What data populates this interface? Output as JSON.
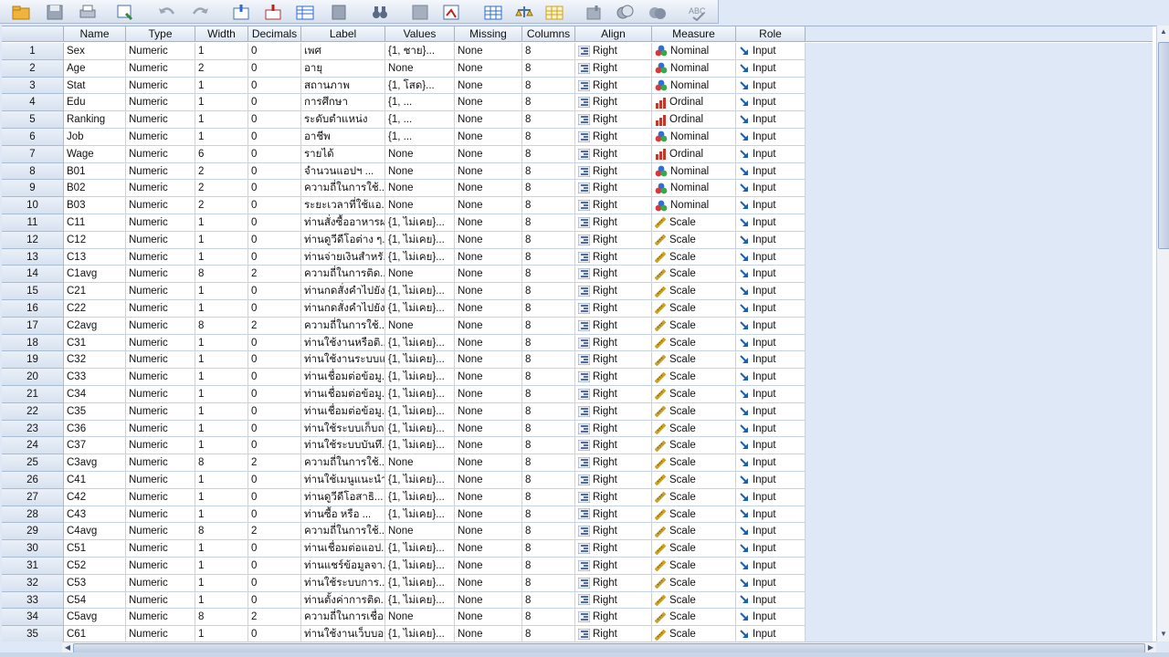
{
  "toolbar": {
    "buttons": [
      "open-icon",
      "save-icon",
      "print-icon",
      "recall-dialog-icon",
      "undo-icon",
      "redo-icon",
      "goto-case-icon",
      "goto-variable-icon",
      "variables-icon",
      "find-icon",
      "binoculars-icon",
      "insert-cases-icon",
      "insert-variable-icon",
      "split-file-icon",
      "weight-cases-icon",
      "select-cases-icon",
      "value-labels-icon",
      "use-sets-icon",
      "show-all-icon",
      "spelling-icon"
    ]
  },
  "columns": [
    "Name",
    "Type",
    "Width",
    "Decimals",
    "Label",
    "Values",
    "Missing",
    "Columns",
    "Align",
    "Measure",
    "Role"
  ],
  "colors": {
    "header_bg": "#dbe5f2",
    "grid_line": "#c6d3e6",
    "nominal_icon": "#2f6fd1",
    "ordinal_icon": "#c0392b",
    "scale_icon": "#c9a227",
    "role_icon": "#1a5fb4"
  },
  "rows": [
    {
      "num": "1",
      "name": "Sex",
      "type": "Numeric",
      "width": "1",
      "decimals": "0",
      "label": "เพศ",
      "values": "{1, ชาย}...",
      "missing": "None",
      "columns": "8",
      "align": "Right",
      "measure": "Nominal",
      "role": "Input"
    },
    {
      "num": "2",
      "name": "Age",
      "type": "Numeric",
      "width": "2",
      "decimals": "0",
      "label": "อายุ",
      "values": "None",
      "missing": "None",
      "columns": "8",
      "align": "Right",
      "measure": "Nominal",
      "role": "Input"
    },
    {
      "num": "3",
      "name": "Stat",
      "type": "Numeric",
      "width": "1",
      "decimals": "0",
      "label": "สถานภาพ",
      "values": "{1, โสด}...",
      "missing": "None",
      "columns": "8",
      "align": "Right",
      "measure": "Nominal",
      "role": "Input"
    },
    {
      "num": "4",
      "name": "Edu",
      "type": "Numeric",
      "width": "1",
      "decimals": "0",
      "label": "การศึกษา",
      "values": "{1, ...",
      "missing": "None",
      "columns": "8",
      "align": "Right",
      "measure": "Ordinal",
      "role": "Input"
    },
    {
      "num": "5",
      "name": "Ranking",
      "type": "Numeric",
      "width": "1",
      "decimals": "0",
      "label": "ระดับตำแหน่ง",
      "values": "{1, ...",
      "missing": "None",
      "columns": "8",
      "align": "Right",
      "measure": "Ordinal",
      "role": "Input"
    },
    {
      "num": "6",
      "name": "Job",
      "type": "Numeric",
      "width": "1",
      "decimals": "0",
      "label": "อาชีพ",
      "values": "{1, ...",
      "missing": "None",
      "columns": "8",
      "align": "Right",
      "measure": "Nominal",
      "role": "Input"
    },
    {
      "num": "7",
      "name": "Wage",
      "type": "Numeric",
      "width": "6",
      "decimals": "0",
      "label": "รายได้",
      "values": "None",
      "missing": "None",
      "columns": "8",
      "align": "Right",
      "measure": "Ordinal",
      "role": "Input"
    },
    {
      "num": "8",
      "name": "B01",
      "type": "Numeric",
      "width": "2",
      "decimals": "0",
      "label": "จำนวนแอปฯ ...",
      "values": "None",
      "missing": "None",
      "columns": "8",
      "align": "Right",
      "measure": "Nominal",
      "role": "Input"
    },
    {
      "num": "9",
      "name": "B02",
      "type": "Numeric",
      "width": "2",
      "decimals": "0",
      "label": "ความถี่ในการใช้...",
      "values": "None",
      "missing": "None",
      "columns": "8",
      "align": "Right",
      "measure": "Nominal",
      "role": "Input"
    },
    {
      "num": "10",
      "name": "B03",
      "type": "Numeric",
      "width": "2",
      "decimals": "0",
      "label": "ระยะเวลาที่ใช้แอ...",
      "values": "None",
      "missing": "None",
      "columns": "8",
      "align": "Right",
      "measure": "Nominal",
      "role": "Input"
    },
    {
      "num": "11",
      "name": "C11",
      "type": "Numeric",
      "width": "1",
      "decimals": "0",
      "label": "ท่านสั่งซื้ออาหารผ...",
      "values": "{1, ไม่เคย}...",
      "missing": "None",
      "columns": "8",
      "align": "Right",
      "measure": "Scale",
      "role": "Input"
    },
    {
      "num": "12",
      "name": "C12",
      "type": "Numeric",
      "width": "1",
      "decimals": "0",
      "label": "ท่านดูวีดีโอต่าง ๆ...",
      "values": "{1, ไม่เคย}...",
      "missing": "None",
      "columns": "8",
      "align": "Right",
      "measure": "Scale",
      "role": "Input"
    },
    {
      "num": "13",
      "name": "C13",
      "type": "Numeric",
      "width": "1",
      "decimals": "0",
      "label": "ท่านจ่ายเงินสำหรั...",
      "values": "{1, ไม่เคย}...",
      "missing": "None",
      "columns": "8",
      "align": "Right",
      "measure": "Scale",
      "role": "Input"
    },
    {
      "num": "14",
      "name": "C1avg",
      "type": "Numeric",
      "width": "8",
      "decimals": "2",
      "label": "ความถี่ในการติด...",
      "values": "None",
      "missing": "None",
      "columns": "8",
      "align": "Right",
      "measure": "Scale",
      "role": "Input"
    },
    {
      "num": "15",
      "name": "C21",
      "type": "Numeric",
      "width": "1",
      "decimals": "0",
      "label": "ท่านกดสั่งคำไปยัง...",
      "values": "{1, ไม่เคย}...",
      "missing": "None",
      "columns": "8",
      "align": "Right",
      "measure": "Scale",
      "role": "Input"
    },
    {
      "num": "16",
      "name": "C22",
      "type": "Numeric",
      "width": "1",
      "decimals": "0",
      "label": "ท่านกดสั่งคำไปยัง...",
      "values": "{1, ไม่เคย}...",
      "missing": "None",
      "columns": "8",
      "align": "Right",
      "measure": "Scale",
      "role": "Input"
    },
    {
      "num": "17",
      "name": "C2avg",
      "type": "Numeric",
      "width": "8",
      "decimals": "2",
      "label": "ความถี่ในการใช้...",
      "values": "None",
      "missing": "None",
      "columns": "8",
      "align": "Right",
      "measure": "Scale",
      "role": "Input"
    },
    {
      "num": "18",
      "name": "C31",
      "type": "Numeric",
      "width": "1",
      "decimals": "0",
      "label": "ท่านใช้งานหรือติ...",
      "values": "{1, ไม่เคย}...",
      "missing": "None",
      "columns": "8",
      "align": "Right",
      "measure": "Scale",
      "role": "Input"
    },
    {
      "num": "19",
      "name": "C32",
      "type": "Numeric",
      "width": "1",
      "decimals": "0",
      "label": "ท่านใช้งานระบบแ...",
      "values": "{1, ไม่เคย}...",
      "missing": "None",
      "columns": "8",
      "align": "Right",
      "measure": "Scale",
      "role": "Input"
    },
    {
      "num": "20",
      "name": "C33",
      "type": "Numeric",
      "width": "1",
      "decimals": "0",
      "label": "ท่านเชื่อมต่อข้อมู...",
      "values": "{1, ไม่เคย}...",
      "missing": "None",
      "columns": "8",
      "align": "Right",
      "measure": "Scale",
      "role": "Input"
    },
    {
      "num": "21",
      "name": "C34",
      "type": "Numeric",
      "width": "1",
      "decimals": "0",
      "label": "ท่านเชื่อมต่อข้อมู...",
      "values": "{1, ไม่เคย}...",
      "missing": "None",
      "columns": "8",
      "align": "Right",
      "measure": "Scale",
      "role": "Input"
    },
    {
      "num": "22",
      "name": "C35",
      "type": "Numeric",
      "width": "1",
      "decimals": "0",
      "label": "ท่านเชื่อมต่อข้อมู...",
      "values": "{1, ไม่เคย}...",
      "missing": "None",
      "columns": "8",
      "align": "Right",
      "measure": "Scale",
      "role": "Input"
    },
    {
      "num": "23",
      "name": "C36",
      "type": "Numeric",
      "width": "1",
      "decimals": "0",
      "label": "ท่านใช้ระบบเก็บถ...",
      "values": "{1, ไม่เคย}...",
      "missing": "None",
      "columns": "8",
      "align": "Right",
      "measure": "Scale",
      "role": "Input"
    },
    {
      "num": "24",
      "name": "C37",
      "type": "Numeric",
      "width": "1",
      "decimals": "0",
      "label": "ท่านใช้ระบบบันทึ...",
      "values": "{1, ไม่เคย}...",
      "missing": "None",
      "columns": "8",
      "align": "Right",
      "measure": "Scale",
      "role": "Input"
    },
    {
      "num": "25",
      "name": "C3avg",
      "type": "Numeric",
      "width": "8",
      "decimals": "2",
      "label": "ความถี่ในการใช้...",
      "values": "None",
      "missing": "None",
      "columns": "8",
      "align": "Right",
      "measure": "Scale",
      "role": "Input"
    },
    {
      "num": "26",
      "name": "C41",
      "type": "Numeric",
      "width": "1",
      "decimals": "0",
      "label": "ท่านใช้เมนูแนะนำ...",
      "values": "{1, ไม่เคย}...",
      "missing": "None",
      "columns": "8",
      "align": "Right",
      "measure": "Scale",
      "role": "Input"
    },
    {
      "num": "27",
      "name": "C42",
      "type": "Numeric",
      "width": "1",
      "decimals": "0",
      "label": "ท่านดูวีดีโอสาธิ...",
      "values": "{1, ไม่เคย}...",
      "missing": "None",
      "columns": "8",
      "align": "Right",
      "measure": "Scale",
      "role": "Input"
    },
    {
      "num": "28",
      "name": "C43",
      "type": "Numeric",
      "width": "1",
      "decimals": "0",
      "label": "ท่านซื้อ หรือ ...",
      "values": "{1, ไม่เคย}...",
      "missing": "None",
      "columns": "8",
      "align": "Right",
      "measure": "Scale",
      "role": "Input"
    },
    {
      "num": "29",
      "name": "C4avg",
      "type": "Numeric",
      "width": "8",
      "decimals": "2",
      "label": "ความถี่ในการใช้...",
      "values": "None",
      "missing": "None",
      "columns": "8",
      "align": "Right",
      "measure": "Scale",
      "role": "Input"
    },
    {
      "num": "30",
      "name": "C51",
      "type": "Numeric",
      "width": "1",
      "decimals": "0",
      "label": "ท่านเชื่อมต่อแอป...",
      "values": "{1, ไม่เคย}...",
      "missing": "None",
      "columns": "8",
      "align": "Right",
      "measure": "Scale",
      "role": "Input"
    },
    {
      "num": "31",
      "name": "C52",
      "type": "Numeric",
      "width": "1",
      "decimals": "0",
      "label": "ท่านแชร์ข้อมูลจา...",
      "values": "{1, ไม่เคย}...",
      "missing": "None",
      "columns": "8",
      "align": "Right",
      "measure": "Scale",
      "role": "Input"
    },
    {
      "num": "32",
      "name": "C53",
      "type": "Numeric",
      "width": "1",
      "decimals": "0",
      "label": "ท่านใช้ระบบการ...",
      "values": "{1, ไม่เคย}...",
      "missing": "None",
      "columns": "8",
      "align": "Right",
      "measure": "Scale",
      "role": "Input"
    },
    {
      "num": "33",
      "name": "C54",
      "type": "Numeric",
      "width": "1",
      "decimals": "0",
      "label": "ท่านตั้งค่าการติด...",
      "values": "{1, ไม่เคย}...",
      "missing": "None",
      "columns": "8",
      "align": "Right",
      "measure": "Scale",
      "role": "Input"
    },
    {
      "num": "34",
      "name": "C5avg",
      "type": "Numeric",
      "width": "8",
      "decimals": "2",
      "label": "ความถี่ในการเชื่อ...",
      "values": "None",
      "missing": "None",
      "columns": "8",
      "align": "Right",
      "measure": "Scale",
      "role": "Input"
    },
    {
      "num": "35",
      "name": "C61",
      "type": "Numeric",
      "width": "1",
      "decimals": "0",
      "label": "ท่านใช้งานเว็บบอ...",
      "values": "{1, ไม่เคย}...",
      "missing": "None",
      "columns": "8",
      "align": "Right",
      "measure": "Scale",
      "role": "Input"
    }
  ]
}
